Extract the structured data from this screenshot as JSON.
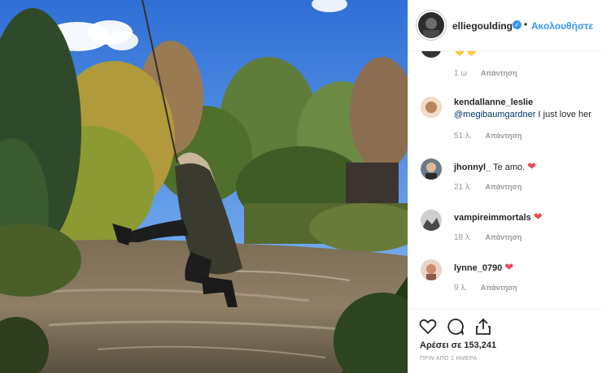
{
  "header": {
    "username": "elliegoulding",
    "follow_label": "Ακολουθήστε",
    "verified_icon": "verified-badge-icon"
  },
  "comments": [
    {
      "username": "",
      "text": "💛💛",
      "time": "1 ω",
      "reply_label": "Απάντηση"
    },
    {
      "username": "kendallanne_leslie",
      "mention": "@megibaumgardner",
      "text": "I just love her",
      "time": "51 λ.",
      "reply_label": "Απάντηση"
    },
    {
      "username": "jhonnyl_",
      "text": "Te amo.",
      "time": "21 λ.",
      "reply_label": "Απάντηση"
    },
    {
      "username": "vampireimmortals",
      "text": "",
      "time": "18 λ.",
      "reply_label": "Απάντηση"
    },
    {
      "username": "lynne_0790",
      "text": "",
      "time": "9 λ.",
      "reply_label": "Απάντηση"
    }
  ],
  "actions": {
    "likes": "Αρέσει σε 153,241",
    "posted": "ΠΡΙΝ ΑΠΟ 1 ΗΜΕΡΑ"
  },
  "colors": {
    "link": "#3897f0",
    "heart": "#ed4956",
    "muted": "#999999"
  }
}
